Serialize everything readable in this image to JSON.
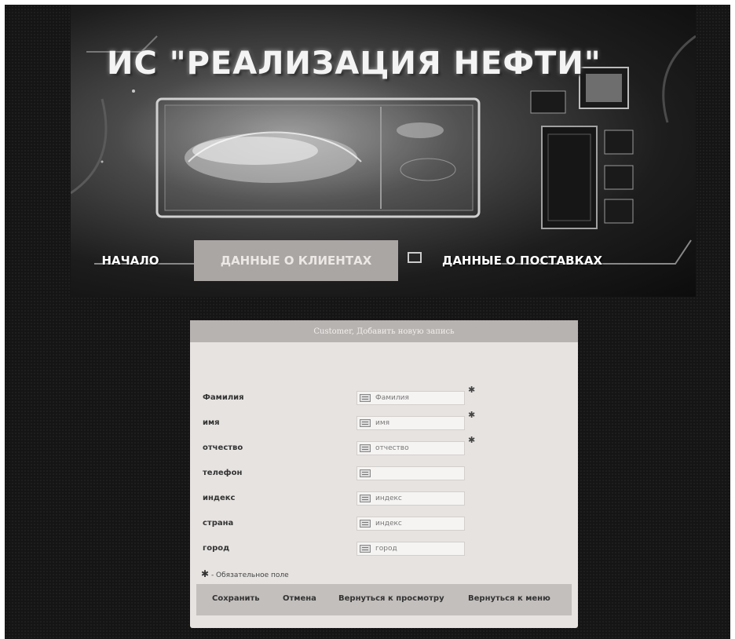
{
  "banner": {
    "title": "ИС \"РЕАЛИЗАЦИЯ НЕФТИ\""
  },
  "nav": {
    "start": "НАЧАЛО",
    "clients": "ДАННЫЕ О КЛИЕНТАХ",
    "supplies": "ДАННЫЕ О ПОСТАВКАХ",
    "active": "clients"
  },
  "form": {
    "header": "Customer, Добавить новую запись",
    "fields": [
      {
        "label": "Фамилия",
        "placeholder": "Фамилия",
        "required": true
      },
      {
        "label": "имя",
        "placeholder": "имя",
        "required": true
      },
      {
        "label": "отчество",
        "placeholder": "отчество",
        "required": true
      },
      {
        "label": "телефон",
        "placeholder": "",
        "required": false
      },
      {
        "label": "индекс",
        "placeholder": "индекс",
        "required": false
      },
      {
        "label": "страна",
        "placeholder": "индекс",
        "required": false
      },
      {
        "label": "город",
        "placeholder": "город",
        "required": false
      }
    ],
    "required_symbol": "✱",
    "required_note": "- Обязательное поле",
    "buttons": {
      "save": "Сохранить",
      "cancel": "Отмена",
      "back_to_view": "Вернуться к просмотру",
      "back_to_menu": "Вернуться к меню"
    }
  },
  "colors": {
    "page_background": "#151515",
    "panel_background": "#e6e3e1",
    "active_tab": "#aaa6a4"
  }
}
